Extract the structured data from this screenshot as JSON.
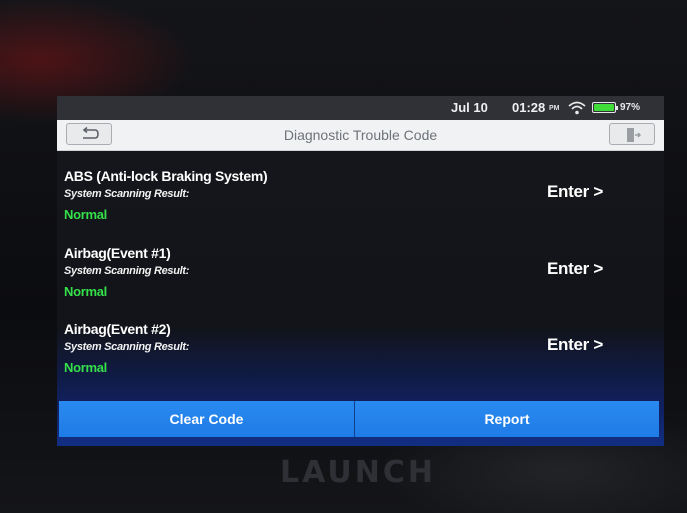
{
  "status_bar": {
    "date": "Jul 10",
    "time": "01:28",
    "ampm": "PM",
    "battery": "97%",
    "icons": [
      "wifi-icon",
      "battery-icon"
    ]
  },
  "header": {
    "title": "Diagnostic Trouble Code",
    "back_icon": "back-arrow-icon",
    "exit_icon": "exit-icon"
  },
  "systems": [
    {
      "name": "ABS (Anti-lock Braking System)",
      "label": "System Scanning Result:",
      "status": "Normal",
      "action": "Enter >"
    },
    {
      "name": "Airbag(Event #1)",
      "label": "System Scanning Result:",
      "status": "Normal",
      "action": "Enter >"
    },
    {
      "name": "Airbag(Event #2)",
      "label": "System Scanning Result:",
      "status": "Normal",
      "action": "Enter >"
    }
  ],
  "footer": {
    "clear_code": "Clear Code",
    "report": "Report"
  },
  "device": {
    "brand": "LAUNCH"
  },
  "colors": {
    "accent": "#1f7be6",
    "status_normal": "#35e04a",
    "title_bar": "#f1f2f4"
  }
}
